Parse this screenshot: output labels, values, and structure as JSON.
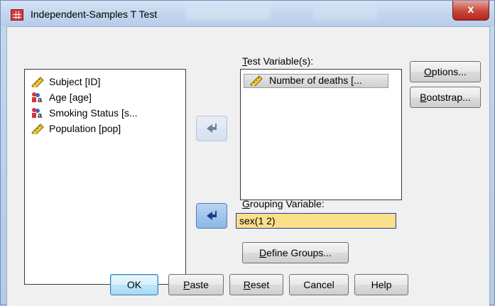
{
  "window": {
    "title": "Independent-Samples T Test",
    "close_glyph": "x"
  },
  "source_list": {
    "items": [
      {
        "label": "Subject [ID]",
        "icon": "ruler-scale-icon"
      },
      {
        "label": "Age [age]",
        "icon": "nominal-person-icon"
      },
      {
        "label": "Smoking Status [s...",
        "icon": "nominal-person-icon"
      },
      {
        "label": "Population [pop]",
        "icon": "ruler-scale-icon"
      }
    ]
  },
  "test_variables": {
    "label_mnemonic": "T",
    "label_rest": "est Variable(s):",
    "items": [
      {
        "label": "Number of deaths [...",
        "icon": "ruler-scale-icon"
      }
    ]
  },
  "grouping": {
    "label_mnemonic": "G",
    "label_rest": "rouping Variable:",
    "value": "sex(1 2)",
    "define_mnemonic": "D",
    "define_rest": "efine Groups..."
  },
  "side_buttons": {
    "options_mnemonic": "O",
    "options_rest": "ptions...",
    "bootstrap_mnemonic": "B",
    "bootstrap_rest": "ootstrap..."
  },
  "footer_buttons": {
    "ok": "OK",
    "paste_mnemonic": "P",
    "paste_rest": "aste",
    "reset_mnemonic": "R",
    "reset_rest": "eset",
    "cancel": "Cancel",
    "help": "Help"
  },
  "colors": {
    "grouping_field_bg": "#fbe08a",
    "close_button": "#c6463a"
  }
}
